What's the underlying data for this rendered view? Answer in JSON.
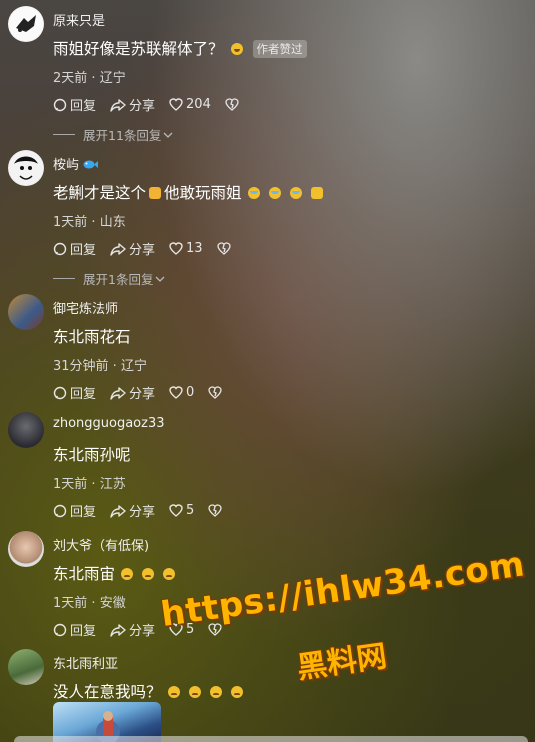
{
  "comments": [
    {
      "user": "原来只是",
      "text": "雨姐好像是苏联解体了？",
      "badge": "作者赞过",
      "time": "2天前",
      "location": "辽宁",
      "reply": "回复",
      "share": "分享",
      "likes": "204",
      "expand": "展开11条回复"
    },
    {
      "user": "桉屿",
      "text": "老鯏才是这个",
      "text2": "他敢玩雨姐",
      "time": "1天前",
      "location": "山东",
      "reply": "回复",
      "share": "分享",
      "likes": "13",
      "expand": "展开1条回复"
    },
    {
      "user": "御宅炼法师",
      "text": "东北雨花石",
      "time": "31分钟前",
      "location": "辽宁",
      "reply": "回复",
      "share": "分享",
      "likes": "0"
    },
    {
      "user": "zhongguogaoz33",
      "text": "东北雨孙呢",
      "time": "1天前",
      "location": "江苏",
      "reply": "回复",
      "share": "分享",
      "likes": "5"
    },
    {
      "user": "刘大爷（有低保)",
      "text": "东北雨宙",
      "time": "1天前",
      "location": "安徽",
      "reply": "回复",
      "share": "分享",
      "likes": "5"
    },
    {
      "user": "东北雨利亚",
      "text": "没人在意我吗？"
    }
  ],
  "watermark": {
    "url": "https://ihlw34.com",
    "name": "黑料网"
  },
  "colors": {
    "watermark": "#ffb400",
    "badge_bg": "rgba(255,255,255,0.25)"
  }
}
